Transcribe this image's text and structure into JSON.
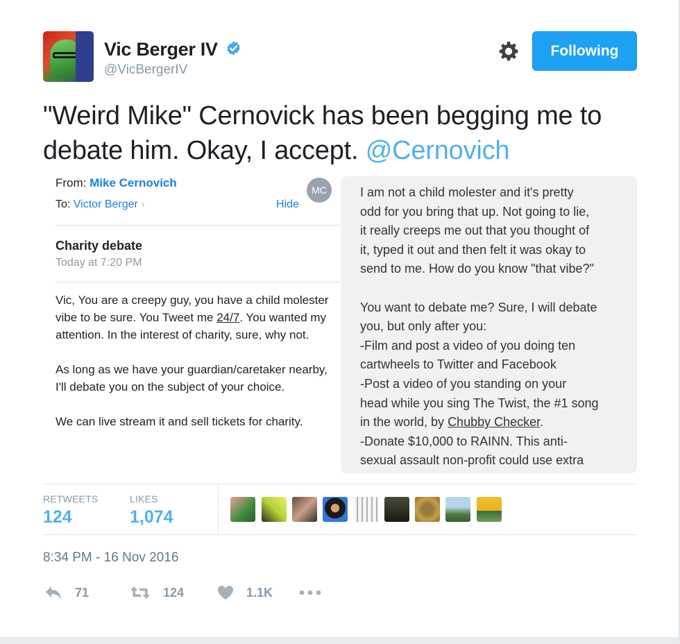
{
  "tweet": {
    "author_name": "Vic Berger IV",
    "author_handle": "@VicBergerIV",
    "follow_label": "Following",
    "text": "\"Weird Mike\" Cernovick has been begging me to debate him. Okay, I accept. ",
    "mention": "@Cernovich",
    "timestamp": "8:34 PM - 16 Nov 2016"
  },
  "email": {
    "from_label": "From:",
    "from_name": "Mike Cernovich",
    "to_label": "To:",
    "to_name": "Victor Berger",
    "hide_label": "Hide",
    "initials": "MC",
    "subject": "Charity debate",
    "date": "Today at 7:20 PM",
    "p1_a": "Vic, You are a creepy guy, you have a child molester vibe to be sure. You Tweet me ",
    "p1_link": "24/7",
    "p1_b": ". You wanted my attention. In the interest of charity, sure, why not.",
    "p2": "As long as we have your guardian/caretaker nearby, I'll debate you on the subject of your choice.",
    "p3": "We can live stream it and sell tickets for charity."
  },
  "reply": {
    "lines": [
      "I am not a child molester and it's pretty",
      "odd for you bring that up. Not going to lie,",
      "it really creeps me out that you thought of",
      "it, typed it out and then felt it was okay to",
      "send to me. How do you know \"that vibe?\""
    ],
    "lines2": [
      "You want to debate me? Sure, I will debate",
      "you, but only after you:",
      "-Film and post a video of you doing ten",
      "cartwheels to Twitter and Facebook",
      "-Post a video of you standing on your",
      "head while you sing The Twist, the #1 song"
    ],
    "line_pre": "in the world, by ",
    "line_link": "Chubby Checker",
    "line_post": ".",
    "lines3": [
      "-Donate $10,000 to RAINN. This anti-",
      "sexual assault non-profit could use extra"
    ]
  },
  "stats": {
    "retweets_label": "RETWEETS",
    "retweets_value": "124",
    "likes_label": "LIKES",
    "likes_value": "1,074"
  },
  "actions": {
    "reply_count": "71",
    "retweet_count": "124",
    "like_count": "1.1K"
  },
  "colors": {
    "accent": "#1da1f2",
    "mention": "#4fb1ea",
    "muted": "#8899a6"
  }
}
